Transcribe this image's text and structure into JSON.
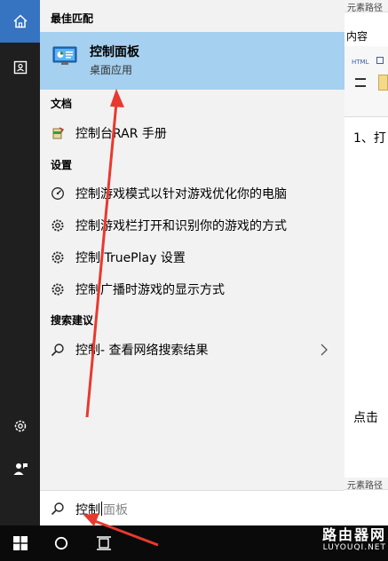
{
  "background_window": {
    "top_row": "元素路径",
    "tab": "内容",
    "tool_html": "HTML",
    "step_text": "1、打",
    "click_text": "点击",
    "bottom_row": "元素路径"
  },
  "rail": {
    "items": [
      {
        "icon": "home-icon"
      },
      {
        "icon": "tablet-mode-icon"
      },
      {
        "icon": "settings-gear-icon"
      },
      {
        "icon": "user-feedback-icon"
      }
    ]
  },
  "results": {
    "best_match_header": "最佳匹配",
    "best_match": {
      "title": "控制面板",
      "subtitle": "桌面应用",
      "icon": "control-panel-icon"
    },
    "documents_header": "文档",
    "documents": [
      {
        "label": "控制台RAR 手册",
        "icon": "rar-help-icon"
      }
    ],
    "settings_header": "设置",
    "settings": [
      {
        "label": "控制游戏模式以针对游戏优化你的电脑",
        "icon": "gauge-icon"
      },
      {
        "label": "控制游戏栏打开和识别你的游戏的方式",
        "icon": "gear-icon"
      },
      {
        "label": "控制 TruePlay 设置",
        "icon": "gear-icon"
      },
      {
        "label": "控制广播时游戏的显示方式",
        "icon": "gear-icon"
      }
    ],
    "suggest_header": "搜索建议",
    "suggestion": {
      "label": "控制",
      "sub": " - 查看网络搜索结果"
    }
  },
  "search": {
    "typed": "控制",
    "ghost": "面板"
  },
  "taskbar": {
    "watermark_cn": "路由器网",
    "watermark_en": "LUYOUQI.NET"
  },
  "colors": {
    "rail": "#1f1f1f",
    "rail_active": "#3673c0",
    "panel": "#f2f2f2",
    "highlight": "#a6d0ef",
    "taskbar": "#0a0a0a",
    "arrow": "#e8392f"
  }
}
